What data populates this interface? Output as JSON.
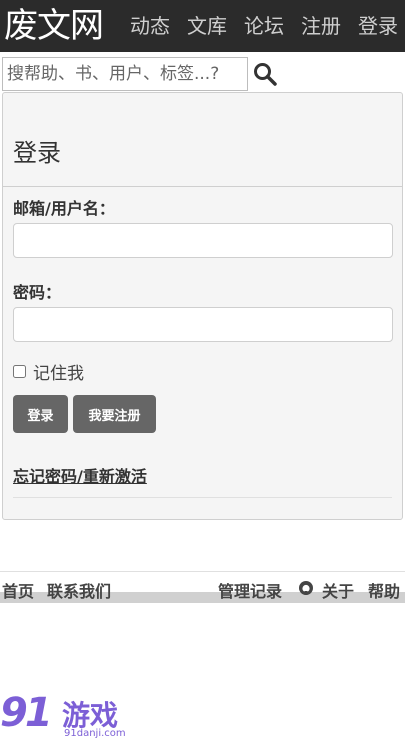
{
  "header": {
    "brand": "废文网",
    "nav": [
      "动态",
      "文库",
      "论坛",
      "注册",
      "登录"
    ]
  },
  "search": {
    "placeholder": "搜帮助、书、用户、标签...?",
    "icon": "search-icon"
  },
  "login": {
    "title": "登录",
    "email_label": "邮箱/用户名：",
    "email_value": "",
    "password_label": "密码：",
    "password_value": "",
    "remember_label": "记住我",
    "remember_checked": false,
    "login_button": "登录",
    "register_button": "我要注册",
    "forgot_link": "忘记密码/重新激活"
  },
  "footer": {
    "home": "首页",
    "contact": "联系我们",
    "admin_log": "管理记录",
    "github_icon": "github-icon",
    "about": "关于",
    "help": "帮助"
  },
  "watermark": {
    "logo_number": "91",
    "logo_text": "游戏",
    "url": "91danji.com"
  },
  "colors": {
    "topbar": "#2b2b2b",
    "button": "#666666",
    "panel_bg": "#f5f5f5",
    "watermark": "#7c5fd6"
  }
}
